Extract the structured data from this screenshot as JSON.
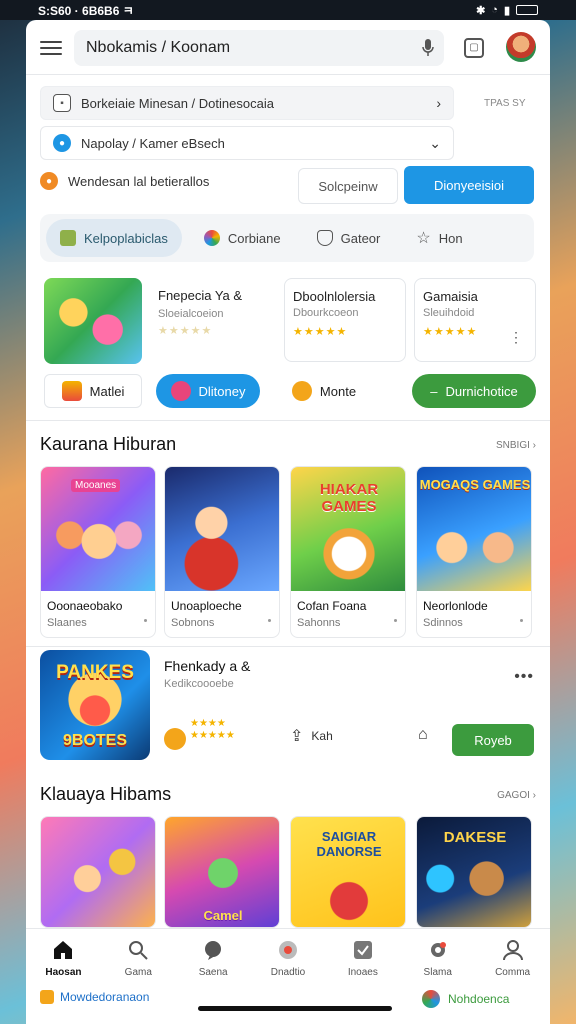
{
  "status": {
    "time": "S:S60 · 6B6B6 ㅋ"
  },
  "search": {
    "value": "Nbokamis / Koonam"
  },
  "filters": {
    "side_label": "TPAS SY",
    "row1_text": "Borkeiaie Minesan / Dotinesocaia",
    "row2_text": "Napolay / Kamer eBsech",
    "row3_text": "Wendesan lal betierallos",
    "outline_button": "Solcpeinw",
    "primary_button": "Dionyeeisioi"
  },
  "tabs": [
    {
      "label": "Kelpoplabiclas",
      "icon": "gift-icon"
    },
    {
      "label": "Corbiane",
      "icon": "palette-icon"
    },
    {
      "label": "Gateor",
      "icon": "shield-icon"
    },
    {
      "label": "Hon",
      "icon": "star-icon"
    }
  ],
  "promos": [
    {
      "title": "Fnepecia Ya &",
      "sub": "Sloeialcoeion",
      "stars": "★★★★★"
    },
    {
      "title": "Dboolnlolersia",
      "sub": "Dbourkcoeon",
      "stars": "★★★★★"
    },
    {
      "title": "Gamaisia",
      "sub": "Sleuihdoid",
      "stars": "★★★★★"
    }
  ],
  "actions": [
    {
      "label": "Matlei"
    },
    {
      "label": "Dlitoney"
    },
    {
      "label": "Monte"
    },
    {
      "label": "Durnichotice"
    }
  ],
  "section1": {
    "title": "Kaurana Hiburan",
    "link": "SNBIGI",
    "games": [
      {
        "name": "Ooonaeobako",
        "sub": "Slaanes",
        "art_text": "Mooanes"
      },
      {
        "name": "Unoaploeche",
        "sub": "Sobnons",
        "art_text": ""
      },
      {
        "name": "Cofan Foana",
        "sub": "Sahonns",
        "art_text": "HIAKAR GAMES"
      },
      {
        "name": "Neorlonlode",
        "sub": "Sdinnos",
        "art_text": "MOGAQS GAMES"
      }
    ]
  },
  "feature": {
    "art_text_top": "PANKES",
    "art_text_bottom": "9BOTES",
    "title": "Fhenkady a &",
    "sub": "Kedikcoooebe",
    "stars_top": "★★★★",
    "stars_bottom": "★★★★★",
    "action1": "Kah",
    "action_button": "Royeb"
  },
  "section2": {
    "title": "Klauaya Hibams",
    "link": "GAGOI",
    "games": [
      {
        "art_text": ""
      },
      {
        "art_text": "Camel"
      },
      {
        "art_text": "SAIGIAR DANORSE"
      },
      {
        "art_text": "DAKESE"
      }
    ]
  },
  "nav": [
    {
      "label": "Haosan",
      "icon": "home-icon"
    },
    {
      "label": "Gama",
      "icon": "search-icon"
    },
    {
      "label": "Saena",
      "icon": "chat-icon"
    },
    {
      "label": "Dnadtio",
      "icon": "record-icon"
    },
    {
      "label": "Inoaes",
      "icon": "library-icon"
    },
    {
      "label": "Slama",
      "icon": "settings-icon"
    },
    {
      "label": "Comma",
      "icon": "profile-icon"
    }
  ],
  "bottom_strip": {
    "left": "Mowdedoranaon",
    "right": "Nohdoenca"
  },
  "colors": {
    "primary": "#1e96e4",
    "success": "#3c9b3e",
    "star": "#f4b400"
  }
}
